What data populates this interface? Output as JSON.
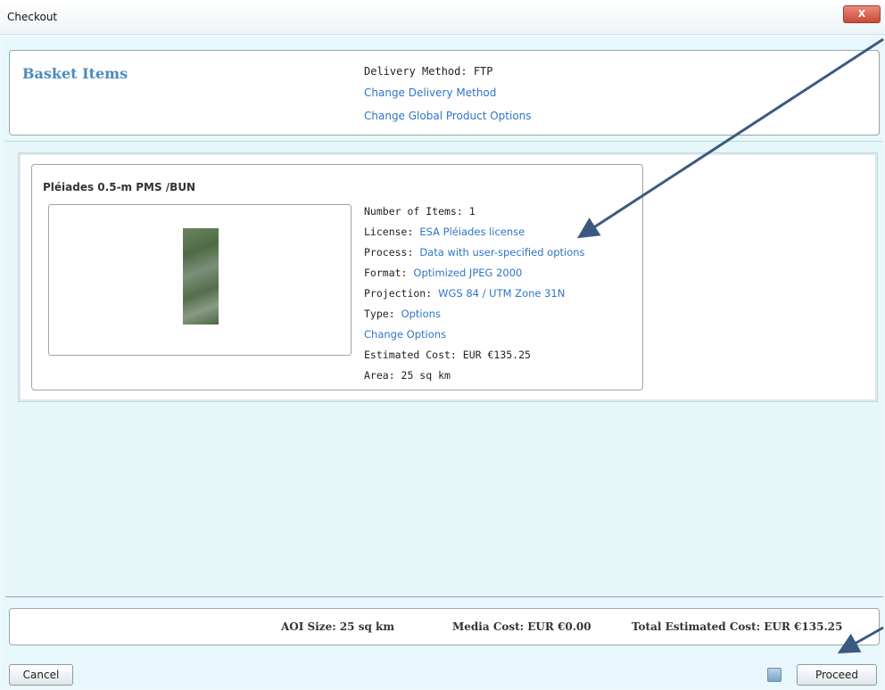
{
  "window": {
    "title": "Checkout",
    "close_label": "X"
  },
  "basket": {
    "title": "Basket Items",
    "delivery_method": "Delivery Method: FTP",
    "change_delivery": "Change Delivery Method",
    "change_global": "Change Global Product Options"
  },
  "item": {
    "title": "Pléiades 0.5-m PMS /BUN",
    "number_of_items": "Number of Items: 1",
    "license_label": "License:",
    "license_value": "ESA Pléiades license",
    "process_label": "Process:",
    "process_value": "Data with user-specified options",
    "format_label": "Format:",
    "format_value": "Optimized JPEG 2000",
    "projection_label": "Projection:",
    "projection_value": "WGS 84 / UTM Zone 31N",
    "type_label": "Type:",
    "type_value": "Options",
    "change_options": "Change Options",
    "estimated_cost": "Estimated Cost: EUR €135.25",
    "area": "Area: 25 sq km"
  },
  "summary": {
    "aoi_size": "AOI Size: 25 sq km",
    "media_cost": "Media Cost: EUR €0.00",
    "total_cost": "Total Estimated Cost: EUR €135.25"
  },
  "buttons": {
    "cancel": "Cancel",
    "proceed": "Proceed"
  },
  "colors": {
    "link": "#2f75c6",
    "title_accent": "#4a8bbf",
    "arrow": "#3b5a80",
    "close": "#c94a35"
  }
}
